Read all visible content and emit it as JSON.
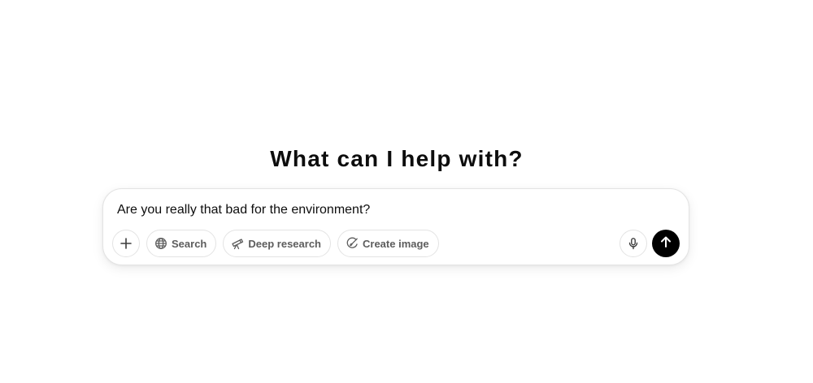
{
  "heading": "What can I help with?",
  "composer": {
    "input_value": "Are you really that bad for the environment?",
    "tools": [
      {
        "label": "Search",
        "icon": "globe-icon"
      },
      {
        "label": "Deep research",
        "icon": "telescope-icon"
      },
      {
        "label": "Create image",
        "icon": "image-brush-icon"
      }
    ],
    "add_icon": "plus-icon",
    "mic_icon": "microphone-icon",
    "send_icon": "arrow-up-icon"
  }
}
